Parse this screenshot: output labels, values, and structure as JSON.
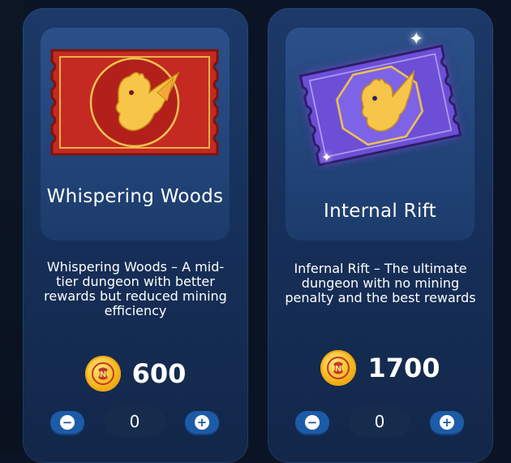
{
  "packs": [
    {
      "title": "Whispering Woods",
      "description": "Whispering Woods – A mid-tier dungeon with better rewards but reduced mining efficiency",
      "price": "600",
      "quantity": "0",
      "ticket_color": "#c42a22",
      "icon": "dragon-ticket-icon"
    },
    {
      "title": "Internal Rift",
      "description": "Infernal Rift – The ultimate dungeon with no mining penalty and the best rewards",
      "price": "1700",
      "quantity": "0",
      "ticket_color": "#6c4fd6",
      "icon": "dragon-ticket-icon"
    }
  ],
  "controls": {
    "minus_label": "−",
    "plus_label": "+"
  },
  "coin_icon": "coin-icon"
}
